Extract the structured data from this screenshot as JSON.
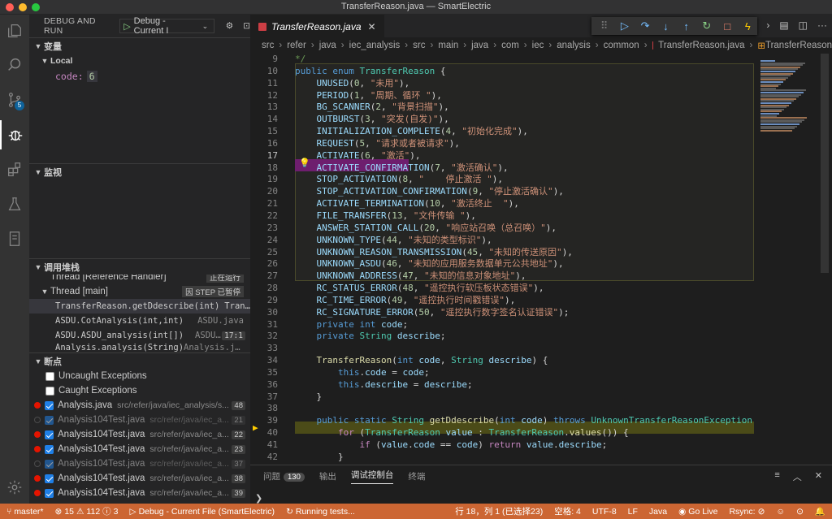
{
  "window": {
    "title": "TransferReason.java — SmartElectric"
  },
  "sidebar": {
    "header": "DEBUG AND RUN",
    "config": "Debug - Current I",
    "variables": {
      "title": "变量",
      "scope": "Local",
      "vars": [
        {
          "name": "code:",
          "value": "6"
        }
      ]
    },
    "watch": {
      "title": "监视"
    },
    "callstack": {
      "title": "调用堆栈",
      "threads": [
        {
          "name": "Thread [Reference Handler]",
          "state": "正在运行"
        },
        {
          "name": "Thread [main]",
          "state": "因 STEP 已暂停"
        }
      ],
      "frames": [
        {
          "fn": "TransferReason.getDdescribe(int)",
          "file": "Transfe..."
        },
        {
          "fn": "ASDU.CotAnalysis(int,int)",
          "file": "ASDU.java"
        },
        {
          "fn": "ASDU.ASDU_analysis(int[])",
          "file": "ASDU.java",
          "line": "17:1"
        },
        {
          "fn": "Analysis.analysis(String)",
          "file": "Analysis.java"
        }
      ]
    },
    "breakpoints": {
      "title": "断点",
      "items": [
        {
          "label": "Uncaught Exceptions"
        },
        {
          "label": "Caught Exceptions"
        },
        {
          "label": "Analysis.java",
          "path": "src/refer/java/iec_analysis/s...",
          "line": "48"
        },
        {
          "label": "Analysis104Test.java",
          "path": "src/refer/java/iec_a...",
          "line": "21"
        },
        {
          "label": "Analysis104Test.java",
          "path": "src/refer/java/iec_a...",
          "line": "22"
        },
        {
          "label": "Analysis104Test.java",
          "path": "src/refer/java/iec_a...",
          "line": "23"
        },
        {
          "label": "Analysis104Test.java",
          "path": "src/refer/java/iec_a...",
          "line": "37"
        },
        {
          "label": "Analysis104Test.java",
          "path": "src/refer/java/iec_a...",
          "line": "38"
        },
        {
          "label": "Analysis104Test.java",
          "path": "src/refer/java/iec_a...",
          "line": "39"
        }
      ]
    }
  },
  "editor": {
    "tab": "TransferReason.java",
    "breadcrumb": [
      "src",
      "refer",
      "java",
      "iec_analysis",
      "src",
      "main",
      "java",
      "com",
      "iec",
      "analysis",
      "common",
      "TransferReason.java",
      "TransferReason"
    ],
    "lines": [
      {
        "n": "9",
        "html": "<span class='cm'>*/</span>"
      },
      {
        "n": "10",
        "html": "<span class='kw'>public</span> <span class='kw'>enum</span> <span class='ty'>TransferReason</span> {"
      },
      {
        "n": "11",
        "html": "    <span class='var'>UNUSED</span>(<span class='num'>0</span>, <span class='str'>\"未用\"</span>),"
      },
      {
        "n": "12",
        "html": "    <span class='var'>PERIOD</span>(<span class='num'>1</span>, <span class='str'>\"周期、循环 \"</span>),"
      },
      {
        "n": "13",
        "html": "    <span class='var'>BG_SCANNER</span>(<span class='num'>2</span>, <span class='str'>\"背景扫描\"</span>),"
      },
      {
        "n": "14",
        "html": "    <span class='var'>OUTBURST</span>(<span class='num'>3</span>, <span class='str'>\"突发(自发)\"</span>),"
      },
      {
        "n": "15",
        "html": "    <span class='var'>INITIALIZATION_COMPLETE</span>(<span class='num'>4</span>, <span class='str'>\"初始化完成\"</span>),"
      },
      {
        "n": "16",
        "html": "    <span class='var'>REQUEST</span>(<span class='num'>5</span>, <span class='str'>\"请求或者被请求\"</span>),"
      },
      {
        "n": "17",
        "html": "    <span class='var'>ACTIVATE</span>(<span class='num'>6</span>, <span class='str'>\"激活\"</span>),"
      },
      {
        "n": "18",
        "html": "    <span class='var'>ACTIVATE_CONFIRMATION</span>(<span class='num'>7</span>, <span class='str'>\"激活确认\"</span>),"
      },
      {
        "n": "19",
        "html": "    <span class='var'>STOP_ACTIVATION</span>(<span class='num'>8</span>, <span class='str'>\"    停止激活 \"</span>),"
      },
      {
        "n": "20",
        "html": "    <span class='var'>STOP_ACTIVATION_CONFIRMATION</span>(<span class='num'>9</span>, <span class='str'>\"停止激活确认\"</span>),"
      },
      {
        "n": "21",
        "html": "    <span class='var'>ACTIVATE_TERMINATION</span>(<span class='num'>10</span>, <span class='str'>\"激活终止  \"</span>),"
      },
      {
        "n": "22",
        "html": "    <span class='var'>FILE_TRANSFER</span>(<span class='num'>13</span>, <span class='str'>\"文件传输 \"</span>),"
      },
      {
        "n": "23",
        "html": "    <span class='var'>ANSWER_STATION_CALL</span>(<span class='num'>20</span>, <span class='str'>\"响应站召唤（总召唤）\"</span>),"
      },
      {
        "n": "24",
        "html": "    <span class='var'>UNKNOWN_TYPE</span>(<span class='num'>44</span>, <span class='str'>\"未知的类型标识\"</span>),"
      },
      {
        "n": "25",
        "html": "    <span class='var'>UNKNOWN_REASON_TRANSMISSION</span>(<span class='num'>45</span>, <span class='str'>\"未知的传送原因\"</span>),"
      },
      {
        "n": "26",
        "html": "    <span class='var'>UNKNOWN_ASDU</span>(<span class='num'>46</span>, <span class='str'>\"未知的应用服务数据单元公共地址\"</span>),"
      },
      {
        "n": "27",
        "html": "    <span class='var'>UNKNOWN_ADDRESS</span>(<span class='num'>47</span>, <span class='str'>\"未知的信息对象地址\"</span>),"
      },
      {
        "n": "28",
        "html": "    <span class='var'>RC_STATUS_ERROR</span>(<span class='num'>48</span>, <span class='str'>\"遥控执行软压板状态错误\"</span>),"
      },
      {
        "n": "29",
        "html": "    <span class='var'>RC_TIME_ERROR</span>(<span class='num'>49</span>, <span class='str'>\"遥控执行时间戳错误\"</span>),"
      },
      {
        "n": "30",
        "html": "    <span class='var'>RC_SIGNATURE_ERROR</span>(<span class='num'>50</span>, <span class='str'>\"遥控执行数字签名认证错误\"</span>);"
      },
      {
        "n": "31",
        "html": "    <span class='kw'>private</span> <span class='kw'>int</span> <span class='var'>code</span>;"
      },
      {
        "n": "32",
        "html": "    <span class='kw'>private</span> <span class='ty'>String</span> <span class='var'>describe</span>;"
      },
      {
        "n": "33",
        "html": ""
      },
      {
        "n": "34",
        "html": "    <span class='fn'>TransferReason</span>(<span class='kw'>int</span> <span class='var'>code</span>, <span class='ty'>String</span> <span class='var'>describe</span>) {"
      },
      {
        "n": "35",
        "html": "        <span class='kw'>this</span>.<span class='var'>code</span> = <span class='var'>code</span>;"
      },
      {
        "n": "36",
        "html": "        <span class='kw'>this</span>.<span class='var'>describe</span> = <span class='var'>describe</span>;"
      },
      {
        "n": "37",
        "html": "    }"
      },
      {
        "n": "38",
        "html": ""
      },
      {
        "n": "39",
        "html": "    <span class='kw'>public</span> <span class='kw'>static</span> <span class='ty'>String</span> <span class='fn'>getDdescribe</span>(<span class='kw'>int</span> <span class='var'>code</span>) <span class='kw'>throws</span> <span class='ty'>UnknownTransferReasonException</span> {"
      },
      {
        "n": "40",
        "html": "        <span class='ctl'>for</span> (<span class='ty'>TransferReason</span> <span class='var'>value</span> : <span class='ty'>TransferReason</span>.<span class='fn'>values</span>()) {"
      },
      {
        "n": "41",
        "html": "            <span class='ctl'>if</span> (<span class='var'>value</span>.<span class='var'>code</span> == <span class='var'>code</span>) <span class='ctl'>return</span> <span class='var'>value</span>.<span class='var'>describe</span>;"
      },
      {
        "n": "42",
        "html": "        }"
      }
    ]
  },
  "panel": {
    "tabs": [
      {
        "label": "问题",
        "count": "130"
      },
      {
        "label": "输出"
      },
      {
        "label": "调试控制台"
      },
      {
        "label": "终端"
      }
    ],
    "prompt": "❯"
  },
  "statusbar": {
    "branch": "master*",
    "errors": "15",
    "warnings": "112",
    "info": "3",
    "debug": "Debug - Current File (SmartElectric)",
    "running": "Running tests...",
    "position": "行 18，列 1 (已选择23)",
    "spaces": "空格: 4",
    "encoding": "UTF-8",
    "eol": "LF",
    "language": "Java",
    "golive": "Go Live",
    "rsync": "Rsync:"
  },
  "colors": {
    "statusbar": "#cc6633",
    "accent": "#0e639c",
    "breakpoint": "#e51400"
  }
}
